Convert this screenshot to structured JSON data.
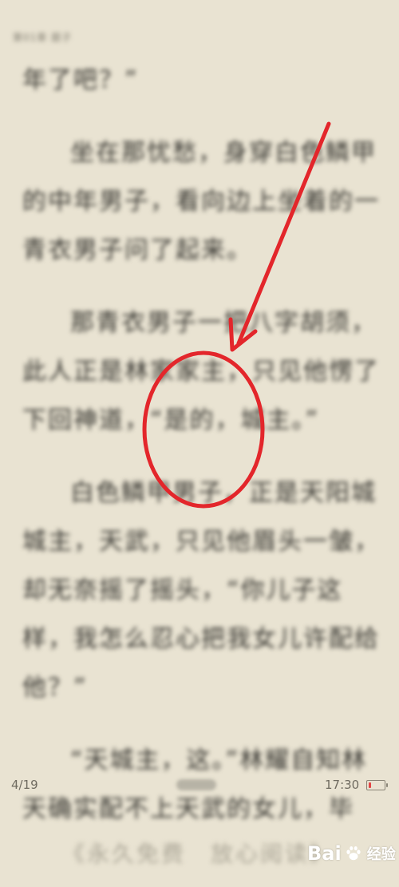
{
  "reader": {
    "chapter_header": "第01章 题子",
    "paragraphs": [
      {
        "text": "年了吧？”",
        "indent": false
      },
      {
        "text": "坐在那忧愁，身穿白色鳞甲的中年男子，看向边上坐着的一青衣男子问了起来。",
        "indent": true
      },
      {
        "text": "那青衣男子一把八字胡须，此人正是林家家主，只见他愣了下回神道，“是的，城主。”",
        "indent": true
      },
      {
        "text": "白色鳞甲男子，正是天阳城城主，天武，只见他眉头一皱，却无奈摇了摇头，“你儿子这样，我怎么忍心把我女儿许配给他？”",
        "indent": true
      },
      {
        "text": "“天城主，这。”林耀自知林天确实配不上天武的女儿，毕",
        "indent": true
      }
    ]
  },
  "status": {
    "page_count": "4/19",
    "time": "17:30",
    "battery_fill_fraction": 0.15,
    "battery_color": "#e34545"
  },
  "banner": {
    "text": "《永久免费　放心阅读》"
  },
  "watermark": {
    "brand": "Bai",
    "brand_suffix": "经验"
  },
  "annotation": {
    "color": "#e3262b"
  }
}
